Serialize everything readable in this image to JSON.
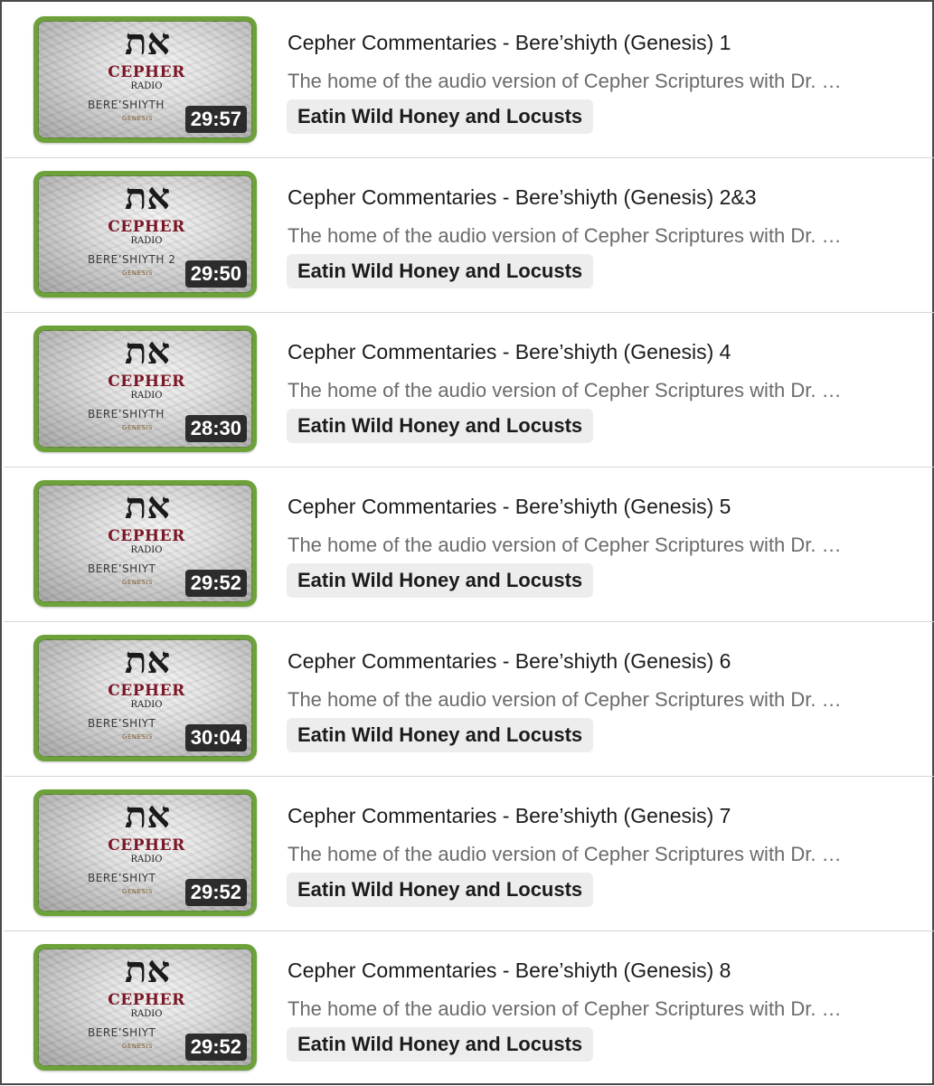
{
  "videos": [
    {
      "title": "Cepher Commentaries - Bere’shiyth (Genesis) 1",
      "description": "The home of the audio version of Cepher Scriptures with Dr. …",
      "channel": "Eatin Wild Honey and Locusts",
      "duration": "29:57",
      "thumb_series": "BERE’SHIYTH"
    },
    {
      "title": "Cepher Commentaries - Bere’shiyth (Genesis) 2&3",
      "description": "The home of the audio version of Cepher Scriptures with Dr. …",
      "channel": "Eatin Wild Honey and Locusts",
      "duration": "29:50",
      "thumb_series": "BERE’SHIYTH 2"
    },
    {
      "title": "Cepher Commentaries - Bere’shiyth (Genesis) 4",
      "description": "The home of the audio version of Cepher Scriptures with Dr. …",
      "channel": "Eatin Wild Honey and Locusts",
      "duration": "28:30",
      "thumb_series": "BERE’SHIYTH"
    },
    {
      "title": "Cepher Commentaries - Bere’shiyth (Genesis) 5",
      "description": "The home of the audio version of Cepher Scriptures with Dr. …",
      "channel": "Eatin Wild Honey and Locusts",
      "duration": "29:52",
      "thumb_series": "BERE’SHIYT"
    },
    {
      "title": "Cepher Commentaries - Bere’shiyth (Genesis) 6",
      "description": "The home of the audio version of Cepher Scriptures with Dr. …",
      "channel": "Eatin Wild Honey and Locusts",
      "duration": "30:04",
      "thumb_series": "BERE’SHIYT"
    },
    {
      "title": "Cepher Commentaries - Bere’shiyth (Genesis) 7",
      "description": "The home of the audio version of Cepher Scriptures with Dr. …",
      "channel": "Eatin Wild Honey and Locusts",
      "duration": "29:52",
      "thumb_series": "BERE’SHIYT"
    },
    {
      "title": "Cepher Commentaries - Bere’shiyth (Genesis) 8",
      "description": "The home of the audio version of Cepher Scriptures with Dr. …",
      "channel": "Eatin Wild Honey and Locusts",
      "duration": "29:52",
      "thumb_series": "BERE’SHIYT"
    }
  ],
  "thumbnail": {
    "glyph": "את",
    "brand": "CEPHER",
    "sub": "RADIO",
    "series_sub": "GENESIS"
  },
  "colors": {
    "thumb_border": "#6da23a",
    "brand": "#7b1626",
    "channel_chip": "#ededed"
  }
}
